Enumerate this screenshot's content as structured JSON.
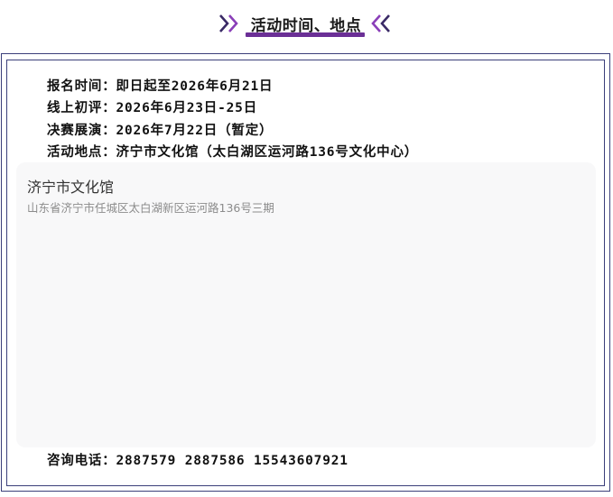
{
  "header": {
    "title": "活动时间、地点",
    "accent_color": "#6b2f96",
    "left_icon": "double-chevron-right-icon",
    "right_icon": "double-chevron-left-icon"
  },
  "info": {
    "signup": {
      "label": "报名时间：",
      "value": "即日起至2026年6月21日"
    },
    "online_review": {
      "label": "线上初评：",
      "value": "2026年6月23日-25日"
    },
    "finals": {
      "label": "决赛展演：",
      "value": "2026年7月22日（暂定）"
    },
    "venue": {
      "label": "活动地点：",
      "value": "济宁市文化馆（太白湖区运河路136号文化中心）"
    }
  },
  "map": {
    "venue_name": "济宁市文化馆",
    "address": "山东省济宁市任城区太白湖新区运河路136号三期"
  },
  "contact": {
    "label": "咨询电话：",
    "value": "2887579 2887586 15543607921"
  },
  "colors": {
    "frame_border": "#3b3f7a",
    "map_background": "#f8f8f9"
  }
}
